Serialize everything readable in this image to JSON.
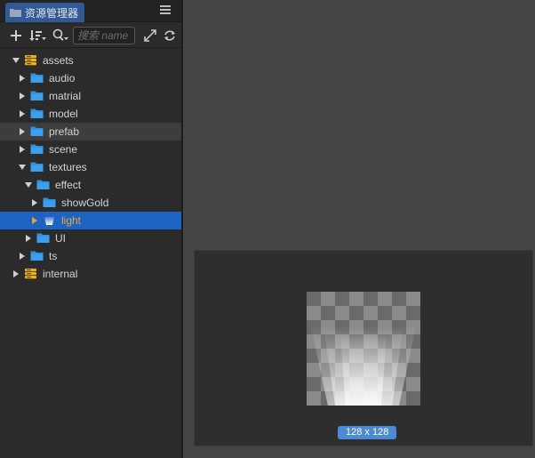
{
  "panel": {
    "title": "资源管理器",
    "search_placeholder": "搜索 name"
  },
  "tree": [
    {
      "label": "assets",
      "type": "db",
      "expanded": true
    },
    {
      "label": "audio",
      "type": "folder",
      "expanded": false
    },
    {
      "label": "matrial",
      "type": "folder",
      "expanded": false
    },
    {
      "label": "model",
      "type": "folder",
      "expanded": false
    },
    {
      "label": "prefab",
      "type": "folder",
      "expanded": false
    },
    {
      "label": "scene",
      "type": "folder",
      "expanded": false
    },
    {
      "label": "textures",
      "type": "folder",
      "expanded": true
    },
    {
      "label": "effect",
      "type": "folder",
      "expanded": true
    },
    {
      "label": "showGold",
      "type": "folder",
      "expanded": false
    },
    {
      "label": "light",
      "type": "image",
      "expanded": false
    },
    {
      "label": "UI",
      "type": "folder",
      "expanded": false
    },
    {
      "label": "ts",
      "type": "folder",
      "expanded": false
    },
    {
      "label": "internal",
      "type": "db",
      "expanded": false
    }
  ],
  "preview": {
    "size_label": "128 x 128"
  },
  "colors": {
    "accent": "#1d63c1",
    "selected_text": "#f2a33a",
    "folder": "#2f8fdf",
    "db": "#f0b020",
    "badge": "#4c8ad6"
  }
}
